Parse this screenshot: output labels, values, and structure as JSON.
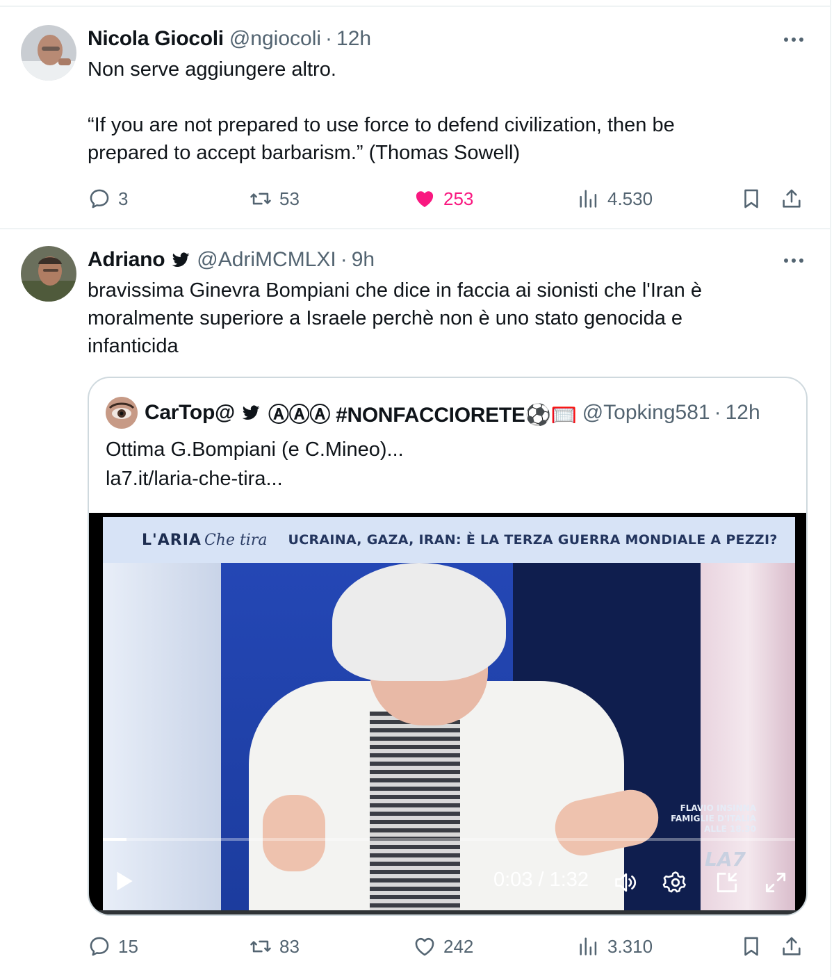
{
  "tweets": [
    {
      "author_name": "Nicola Giocoli",
      "handle": "@ngiocoli",
      "separator": "·",
      "time": "12h",
      "text_lines": [
        "Non serve aggiungere altro.",
        "",
        "“If you are not prepared to use force to defend civilization, then be",
        "prepared to accept barbarism.”  (Thomas Sowell)"
      ],
      "stats": {
        "replies": "3",
        "reposts": "53",
        "likes": "253",
        "views": "4.530"
      },
      "liked": true
    },
    {
      "author_name": "Adriano",
      "handle": "@AdriMCMLXI",
      "separator": "·",
      "time": "9h",
      "verified_icon": "bird-icon",
      "text_lines": [
        "bravissima Ginevra Bompiani  che dice in faccia ai sionisti che l'Iran è",
        "moralmente superiore a Israele perchè non è uno stato genocida e",
        "infanticida"
      ],
      "stats": {
        "replies": "15",
        "reposts": "83",
        "likes": "242",
        "views": "3.310"
      },
      "liked": false,
      "quoted": {
        "author_name": "CarTop@",
        "name_suffix": "ⒶⒶⒶ #NONFACCIORETE⚽🥅",
        "handle": "@Topking581",
        "separator": "·",
        "time": "12h",
        "text_lines": [
          "Ottima G.Bompiani (e C.Mineo)...",
          "la7.it/laria-che-tira..."
        ],
        "video": {
          "banner_logo": "L'ARIA",
          "banner_script": "Che tira",
          "banner_headline": "UCRAINA, GAZA, IRAN: È LA TERZA GUERRA MONDIALE A PEZZI?",
          "promo_lines": [
            "FLAVIO INSINNA",
            "FAMIGLIE D'ITALIA",
            "ALLE 18.30"
          ],
          "channel_logo": "LA7",
          "timecode": "0:03 / 1:32",
          "progress": 0.034
        }
      }
    }
  ],
  "colors": {
    "text": "#0f1419",
    "muted": "#536471",
    "like_pink": "#f91880",
    "border": "#cfd9de",
    "divider": "#eff3f4"
  }
}
